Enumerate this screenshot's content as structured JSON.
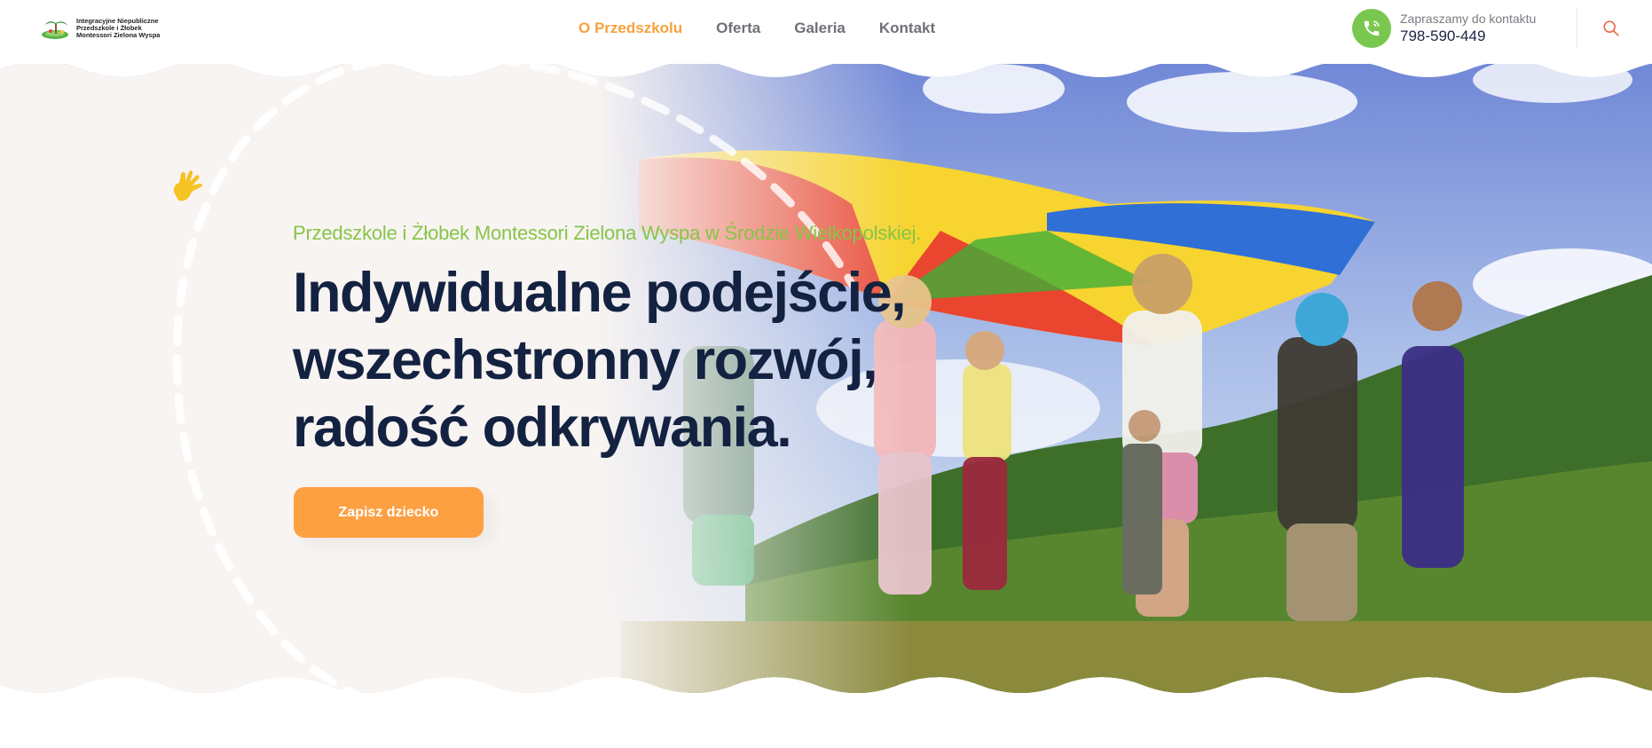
{
  "logo": {
    "line1": "Integracyjne Niepubliczne",
    "line2": "Przedszkole i Żłobek",
    "line3": "Montessori Zielona Wyspa",
    "icon": "island-logo-icon"
  },
  "nav": {
    "items": [
      {
        "label": "O Przedszkolu",
        "active": true
      },
      {
        "label": "Oferta",
        "active": false
      },
      {
        "label": "Galeria",
        "active": false
      },
      {
        "label": "Kontakt",
        "active": false
      }
    ]
  },
  "contact": {
    "label": "Zapraszamy do kontaktu",
    "phone": "798-590-449",
    "icon": "phone-icon"
  },
  "search": {
    "icon": "search-icon"
  },
  "hero": {
    "subtitle": "Przedszkole i Żłobek Montessori Zielona Wyspa w Środzie Wielkopolskiej.",
    "headline_line1": "Indywidualne podejście,",
    "headline_line2": "wszechstronny rozwój,",
    "headline_line3": "radość odkrywania.",
    "cta_label": "Zapisz dziecko",
    "hand_icon": "waving-hand-icon"
  },
  "colors": {
    "accent_orange": "#fda042",
    "nav_active": "#f7a23c",
    "green": "#7ac74f",
    "subtitle_green": "#86c548",
    "headline_navy": "#142241",
    "hero_bg": "#f8f4f2"
  }
}
